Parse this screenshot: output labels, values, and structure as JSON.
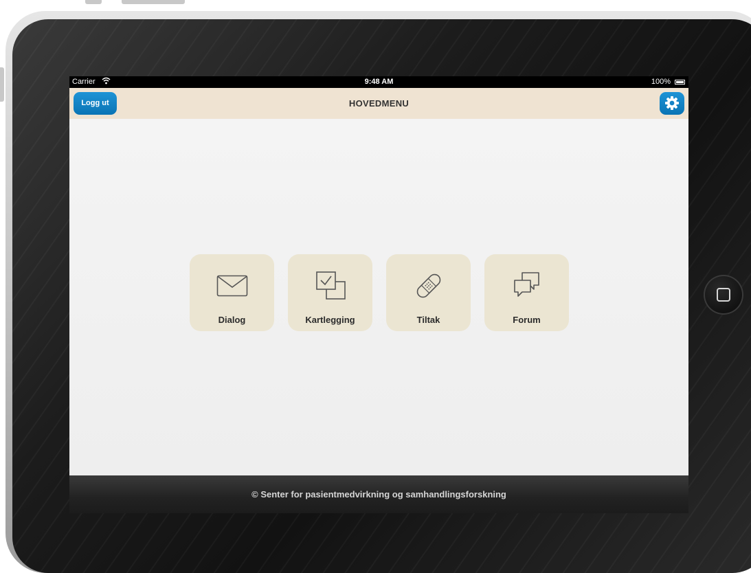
{
  "status_bar": {
    "carrier": "Carrier",
    "time": "9:48 AM",
    "battery": "100%"
  },
  "nav": {
    "title": "HOVEDMENU",
    "logout_label": "Logg ut",
    "settings_icon": "gear-icon"
  },
  "menu": {
    "items": [
      {
        "label": "Dialog",
        "icon": "envelope-icon"
      },
      {
        "label": "Kartlegging",
        "icon": "checklist-icon"
      },
      {
        "label": "Tiltak",
        "icon": "bandage-icon"
      },
      {
        "label": "Forum",
        "icon": "chat-bubbles-icon"
      }
    ]
  },
  "footer": {
    "text": "© Senter for pasientmedvirkning og samhandlingsforskning"
  },
  "colors": {
    "accent": "#1583c6",
    "nav_background": "#efe3d2",
    "tile_background": "#ebe5d2"
  }
}
